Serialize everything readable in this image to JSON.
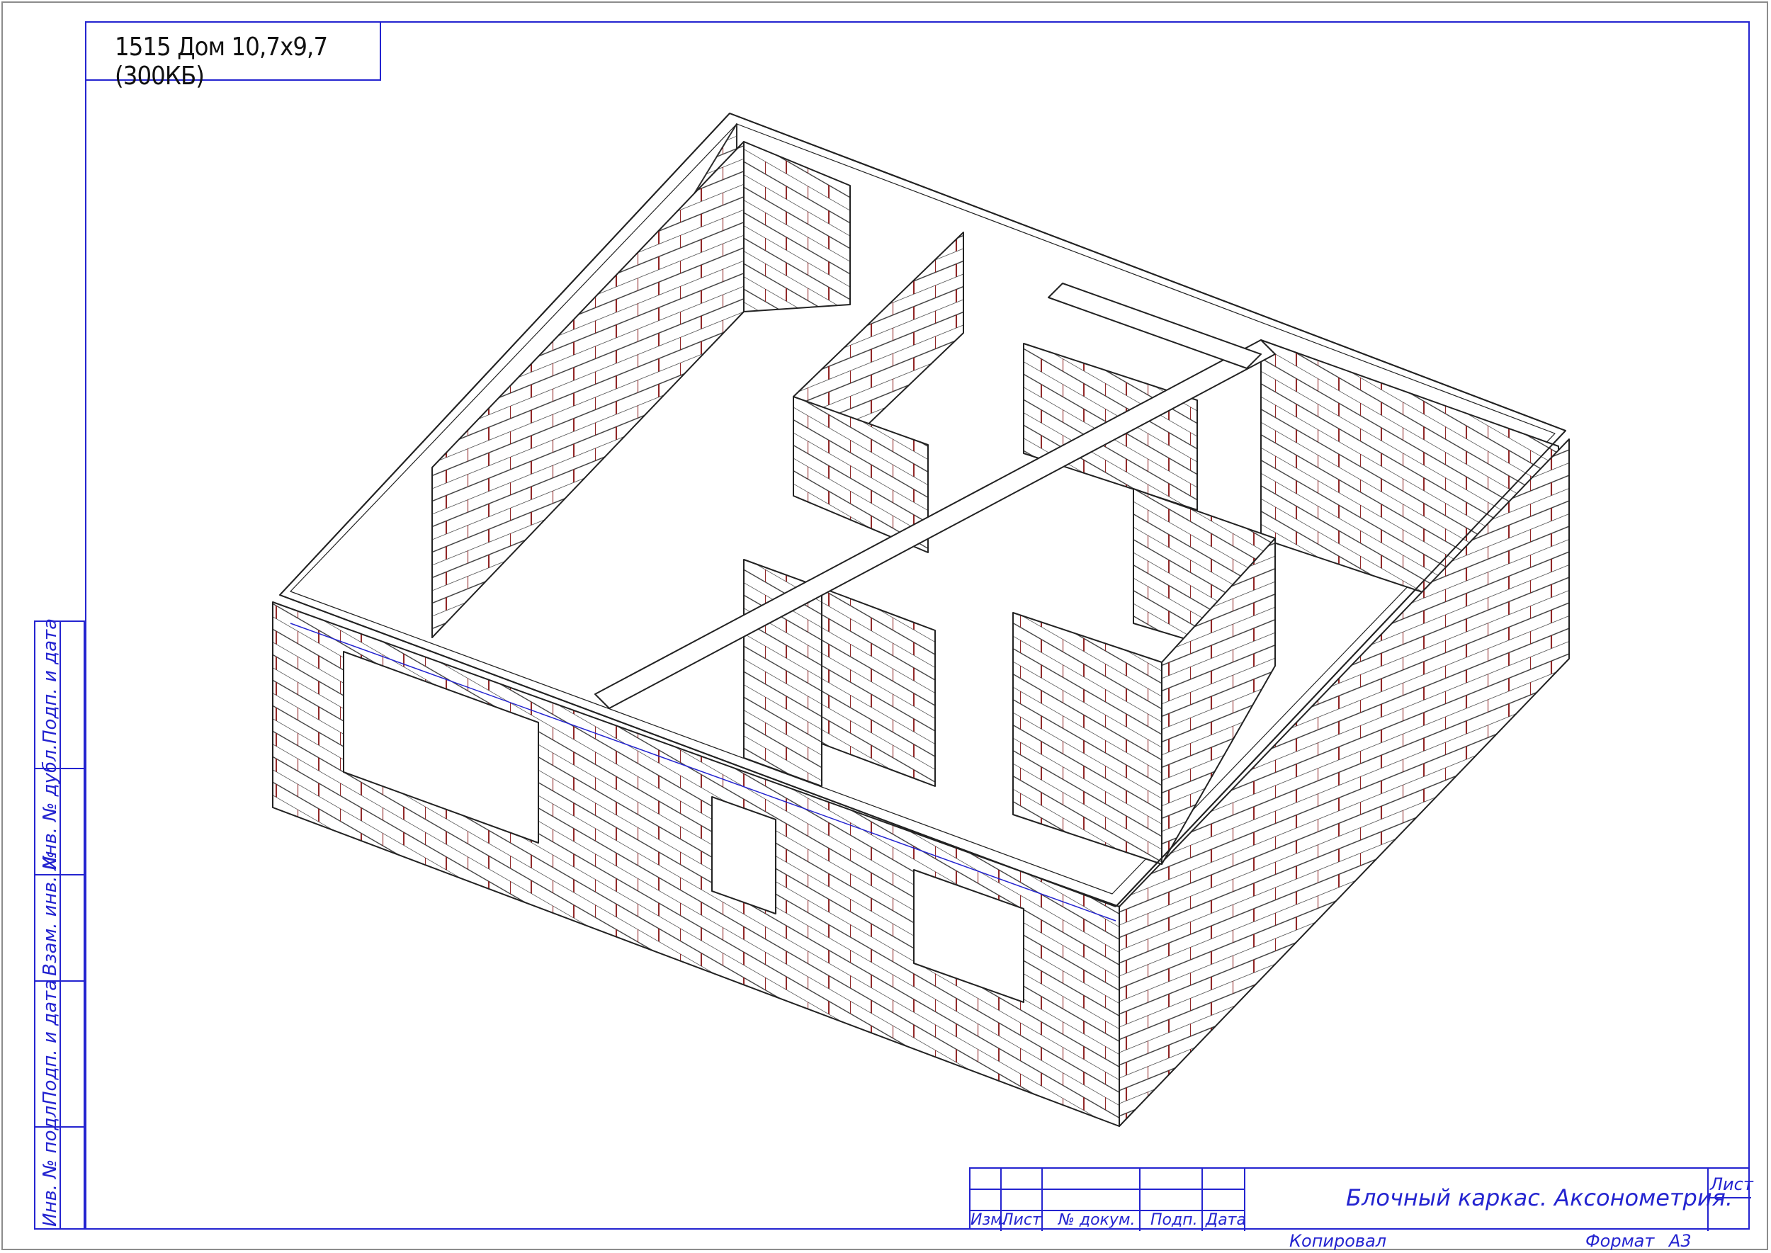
{
  "sheet": {
    "title": "1515 Дом 10,7x9,7 (300КБ)"
  },
  "side_stamp": {
    "labels": [
      "Подп. и дата",
      "Инв. № дубл.",
      "Взам. инв. №",
      "Подп. и дата",
      "Инв. № подл."
    ]
  },
  "title_block": {
    "columns": [
      "Изм.",
      "Лист",
      "№ докум.",
      "Подп.",
      "Дата"
    ],
    "drawing_title": "Блочный каркас. Аксонометрия.",
    "sheet_label": "Лист",
    "copied_label": "Копировал",
    "format_label": "Формат",
    "format_value": "А3"
  },
  "colors": {
    "frame": "#2424d0",
    "brick_lines": "#8b1a1a",
    "outline": "#222222"
  }
}
